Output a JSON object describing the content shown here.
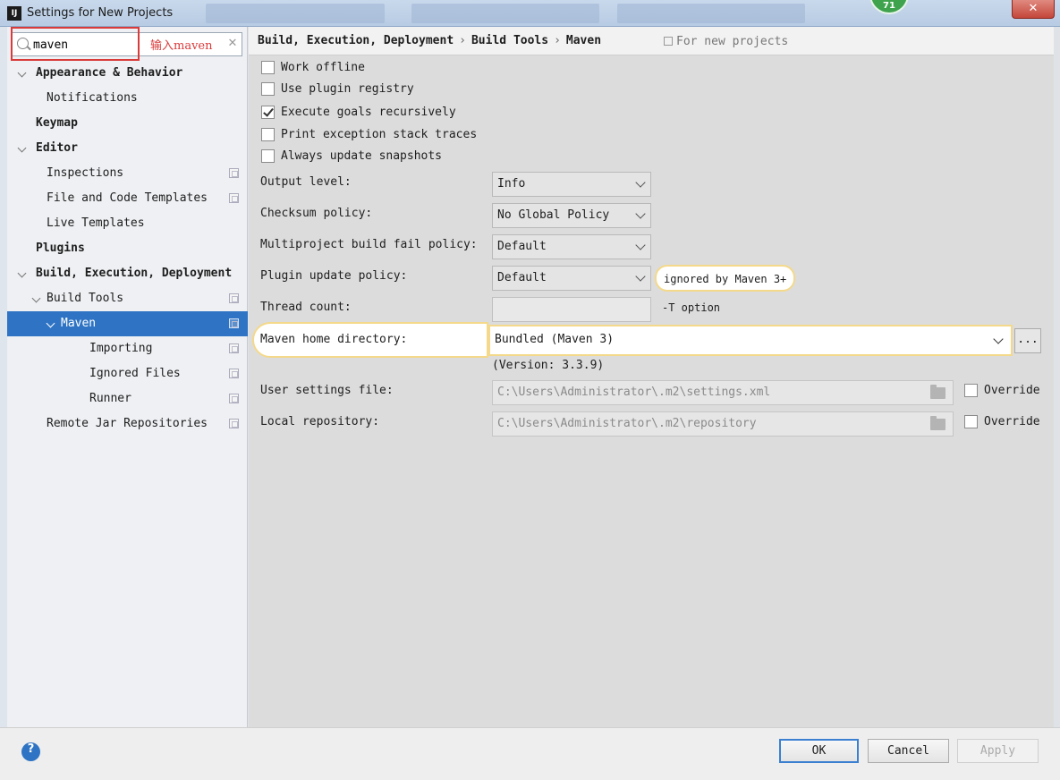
{
  "window": {
    "title": "Settings for New Projects",
    "app_icon": "IJ",
    "close_label": "✕",
    "badge": "71"
  },
  "search": {
    "value": "maven",
    "annotation": "输入maven",
    "clear_glyph": "✕"
  },
  "tree": [
    {
      "label": "Appearance & Behavior",
      "bold": true,
      "level": 0,
      "expandable": true
    },
    {
      "label": "Notifications",
      "bold": false,
      "level": 1,
      "expandable": false
    },
    {
      "label": "Keymap",
      "bold": true,
      "level": 0,
      "expandable": false
    },
    {
      "label": "Editor",
      "bold": true,
      "level": 0,
      "expandable": true
    },
    {
      "label": "Inspections",
      "bold": false,
      "level": 1,
      "expandable": false,
      "copy": true
    },
    {
      "label": "File and Code Templates",
      "bold": false,
      "level": 1,
      "expandable": false,
      "copy": true
    },
    {
      "label": "Live Templates",
      "bold": false,
      "level": 1,
      "expandable": false
    },
    {
      "label": "Plugins",
      "bold": true,
      "level": 0,
      "expandable": false
    },
    {
      "label": "Build, Execution, Deployment",
      "bold": true,
      "level": 0,
      "expandable": true
    },
    {
      "label": "Build Tools",
      "bold": false,
      "level": 1,
      "expandable": true,
      "copy": true
    },
    {
      "label": "Maven",
      "bold": false,
      "level": 2,
      "expandable": true,
      "copy": true,
      "selected": true
    },
    {
      "label": "Importing",
      "bold": false,
      "level": 3,
      "expandable": false,
      "copy": true
    },
    {
      "label": "Ignored Files",
      "bold": false,
      "level": 3,
      "expandable": false,
      "copy": true
    },
    {
      "label": "Runner",
      "bold": false,
      "level": 3,
      "expandable": false,
      "copy": true
    },
    {
      "label": "Remote Jar Repositories",
      "bold": false,
      "level": 1,
      "expandable": false,
      "copy": true
    }
  ],
  "breadcrumb": {
    "items": [
      "Build, Execution, Deployment",
      "Build Tools",
      "Maven"
    ],
    "sep": "›",
    "for_new": "For new projects"
  },
  "checkboxes": [
    {
      "label": "Work offline",
      "checked": false
    },
    {
      "label": "Use plugin registry",
      "checked": false
    },
    {
      "label": "Execute goals recursively",
      "checked": true
    },
    {
      "label": "Print exception stack traces",
      "checked": false
    },
    {
      "label": "Always update snapshots",
      "checked": false
    }
  ],
  "fields": {
    "output_level": {
      "label": "Output level:",
      "value": "Info"
    },
    "checksum_policy": {
      "label": "Checksum policy:",
      "value": "No Global Policy"
    },
    "multiproject": {
      "label": "Multiproject build fail policy:",
      "value": "Default"
    },
    "plugin_update": {
      "label": "Plugin update policy:",
      "value": "Default",
      "hint": "ignored by Maven 3+"
    },
    "thread_count": {
      "label": "Thread count:",
      "value": "",
      "option": "-T option"
    },
    "maven_home": {
      "label": "Maven home directory:",
      "value": "Bundled (Maven 3)",
      "browse": "...",
      "version": "(Version: 3.3.9)"
    },
    "user_settings": {
      "label": "User settings file:",
      "value": "C:\\Users\\Administrator\\.m2\\settings.xml",
      "override": "Override"
    },
    "local_repo": {
      "label": "Local repository:",
      "value": "C:\\Users\\Administrator\\.m2\\repository",
      "override": "Override"
    }
  },
  "footer": {
    "help": "?",
    "ok": "OK",
    "cancel": "Cancel",
    "apply": "Apply"
  }
}
